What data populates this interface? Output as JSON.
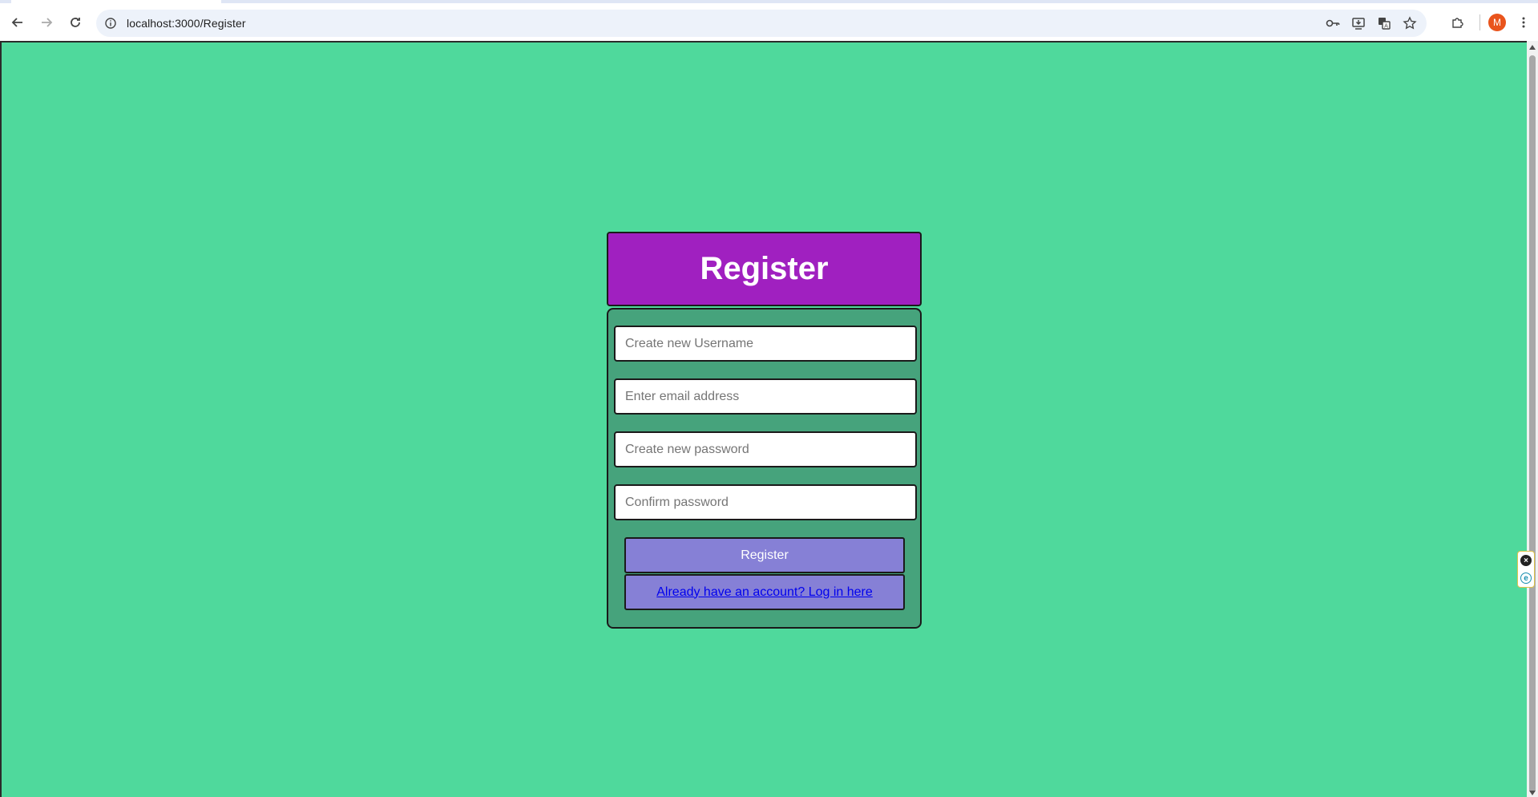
{
  "browser": {
    "url": "localhost:3000/Register",
    "profile_initial": "M",
    "icons": {
      "back": "back-arrow-icon",
      "forward": "forward-arrow-icon",
      "reload": "reload-icon",
      "site_info": "info-icon",
      "password": "key-icon",
      "install": "install-app-icon",
      "translate": "translate-icon",
      "bookmark": "star-icon",
      "extensions": "puzzle-icon",
      "menu": "kebab-menu-icon"
    }
  },
  "page": {
    "background_color": "#4fd99c",
    "header": {
      "title": "Register",
      "color": "#a020c0"
    },
    "form": {
      "background_color": "#46a37c",
      "fields": [
        {
          "placeholder": "Create new Username",
          "value": ""
        },
        {
          "placeholder": "Enter email address",
          "value": ""
        },
        {
          "placeholder": "Create new password",
          "value": ""
        },
        {
          "placeholder": "Confirm password",
          "value": ""
        }
      ],
      "submit_label": "Register",
      "login_link_label": "Already have an account? Log in here",
      "button_color": "#8680d6"
    }
  }
}
